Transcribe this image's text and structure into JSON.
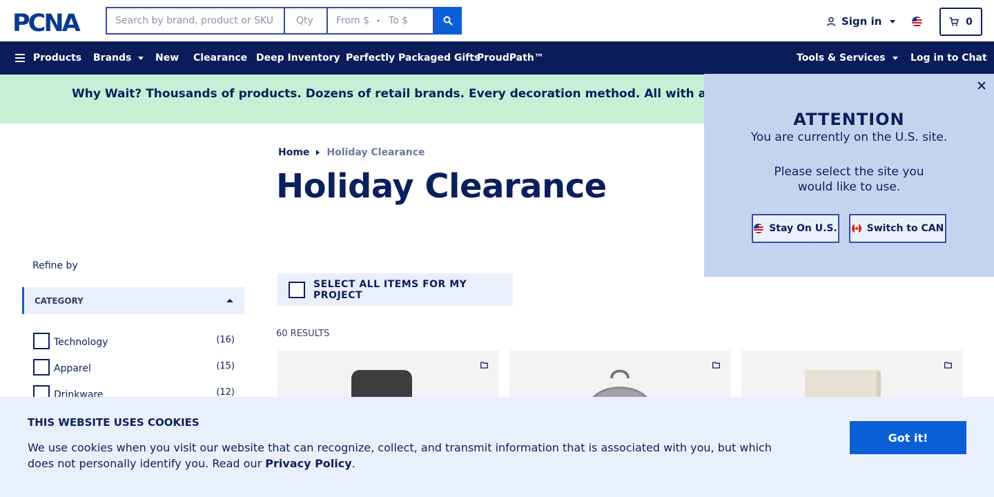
{
  "header": {
    "logo_text": "PCNA",
    "search_placeholder": "Search by brand, product or SKU",
    "qty_placeholder": "Qty",
    "from_placeholder": "From $",
    "to_placeholder": "To $",
    "sign_in": "Sign in",
    "cart_count": "0"
  },
  "nav": {
    "products": "Products",
    "brands": "Brands",
    "new": "New",
    "clearance": "Clearance",
    "deep_inventory": "Deep Inventory",
    "gifts": "Perfectly Packaged Gifts",
    "proudpath": "ProudPath™",
    "tools": "Tools & Services",
    "chat": "Log in to Chat"
  },
  "promo": {
    "text": "Why Wait? Thousands of products. Dozens of retail brands. Every decoration method. All with a standard"
  },
  "breadcrumb": {
    "home": "Home",
    "current": "Holiday Clearance"
  },
  "page": {
    "title": "Holiday Clearance",
    "select_all": "SELECT ALL ITEMS FOR MY PROJECT",
    "results": "60 RESULTS"
  },
  "sidebar": {
    "refine_by": "Refine by",
    "category_header": "CATEGORY",
    "categories": [
      {
        "label": "Technology",
        "count": "(16)"
      },
      {
        "label": "Apparel",
        "count": "(15)"
      },
      {
        "label": "Drinkware",
        "count": "(12)"
      }
    ]
  },
  "site_modal": {
    "title": "ATTENTION",
    "line1": "You are currently on the U.S. site.",
    "line2": "Please select the site you",
    "line3": "would like to use.",
    "stay_us": "Stay On U.S.",
    "switch_can": "Switch to CAN"
  },
  "cookie": {
    "title": "THIS WEBSITE USES COOKIES",
    "text": "We use cookies when you visit our website that can recognize, collect, and transmit information that is associated with you, but which does not personally identify you. Read our ",
    "link": "Privacy Policy",
    "period": ".",
    "button": "Got it!"
  },
  "colors": {
    "navy": "#0b1c5a",
    "primary_blue": "#0a5fd7",
    "promo_green": "#c6efd6",
    "modal_bg": "#c5d4ee",
    "light_panel": "#eaf0fb"
  },
  "icons": [
    "search-icon",
    "user-icon",
    "us-flag-icon",
    "cart-icon",
    "hamburger-icon",
    "close-icon",
    "canada-flag-icon",
    "folder-icon"
  ]
}
